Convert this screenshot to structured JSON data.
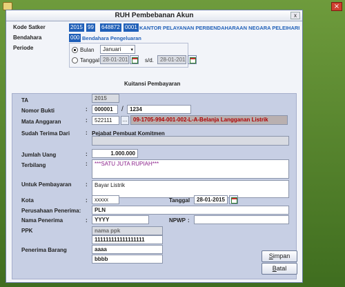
{
  "window": {
    "title": "RUH Pembebanan Akun",
    "close": "x"
  },
  "header": {
    "kode_satker_label": "Kode Satker",
    "kode_satker_parts": [
      "2015",
      "99",
      "648872",
      "0001"
    ],
    "kode_satker_name": "KANTOR PELAYANAN PERBENDAHARAAN NEGARA PELEIHARI",
    "bendahara_label": "Bendahara",
    "bendahara_code": "000",
    "bendahara_name": "Bendahara Pengeluaran",
    "periode_label": "Periode",
    "bulan_label": "Bulan",
    "bulan_value": "Januari",
    "tanggal_label": "Tanggal",
    "tanggal_from": "28-01-2015",
    "sd_label": "s/d.",
    "tanggal_to": "28-01-2015"
  },
  "form": {
    "section_title": "Kuitansi Pembayaran",
    "ta_label": "TA",
    "ta_value": "2015",
    "nomor_bukti_label": "Nomor Bukti",
    "nomor_bukti_1": "000001",
    "slash": "/",
    "nomor_bukti_2": "1234",
    "mata_anggaran_label": "Mata Anggaran",
    "mata_anggaran_code": "522111",
    "ellipsis": "...",
    "mata_anggaran_desc": "09-1705-994-001-002-L-A-Belanja Langganan Listrik",
    "sudah_terima_label": "Sudah Terima Dari",
    "sudah_terima_value": "Pejabat Pembuat Komitmen",
    "jumlah_uang_label": "Jumlah Uang",
    "jumlah_uang_value": "1.000.000",
    "terbilang_label": "Terbilang",
    "terbilang_value": "***SATU JUTA RUPIAH***",
    "untuk_pembayaran_label": "Untuk Pembayaran",
    "untuk_pembayaran_value": "Bayar Listrik",
    "kota_label": "Kota",
    "kota_value": "xxxxx",
    "tanggal_label": "Tanggal",
    "tanggal_value": "28-01-2015",
    "perusahaan_label": "Perusahaan Penerima:",
    "perusahaan_value": "PLN",
    "nama_penerima_label": "Nama  Penerima",
    "nama_penerima_value": "YYYY",
    "npwp_label": "NPWP",
    "ppk_label": "PPK",
    "ppk_name": "nama ppk",
    "ppk_nip": "111111111111111111",
    "penerima_barang_label": "Penerima Barang",
    "penerima_barang_1": "aaaa",
    "penerima_barang_2": "bbbb",
    "colon": ":"
  },
  "buttons": {
    "simpan_u": "S",
    "simpan_rest": "impan",
    "batal_u": "B",
    "batal_rest": "atal"
  }
}
